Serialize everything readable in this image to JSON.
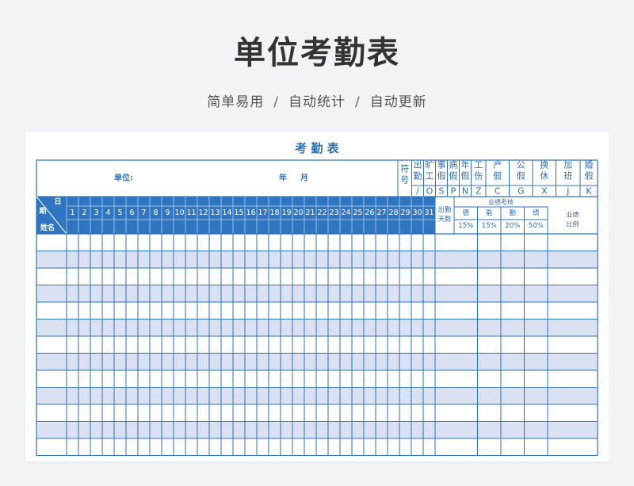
{
  "header": {
    "title": "单位考勤表",
    "subtitle_parts": [
      "简单易用",
      "自动统计",
      "自动更新"
    ],
    "subtitle_sep": "/"
  },
  "sheet": {
    "title": "考 勤 表",
    "unit_label": "单位:",
    "year_label": "年",
    "month_label": "月",
    "symbol_label": "符号",
    "leave_types": [
      {
        "name": "出勤",
        "symbol": "/"
      },
      {
        "name": "旷工",
        "symbol": "O"
      },
      {
        "name": "事假",
        "symbol": "S"
      },
      {
        "name": "病假",
        "symbol": "P"
      },
      {
        "name": "年假",
        "symbol": "N"
      },
      {
        "name": "工伤",
        "symbol": "Z"
      },
      {
        "name": "产假",
        "symbol": "C"
      },
      {
        "name": "公假",
        "symbol": "G"
      },
      {
        "name": "换休",
        "symbol": "X"
      },
      {
        "name": "加班",
        "symbol": "J"
      },
      {
        "name": "婚假",
        "symbol": "K"
      }
    ],
    "corner": {
      "day": "日",
      "period": "期",
      "name": "姓名"
    },
    "days": [
      "1",
      "2",
      "3",
      "4",
      "5",
      "6",
      "7",
      "8",
      "9",
      "10",
      "11",
      "12",
      "13",
      "14",
      "15",
      "16",
      "17",
      "18",
      "19",
      "20",
      "21",
      "22",
      "23",
      "24",
      "25",
      "26",
      "27",
      "28",
      "29",
      "30",
      "31"
    ],
    "attendance_days_label": "出勤天数",
    "perf_label": "业绩考核",
    "perf_items": [
      {
        "name": "德",
        "pct": "15%"
      },
      {
        "name": "能",
        "pct": "15%"
      },
      {
        "name": "勤",
        "pct": "20%"
      },
      {
        "name": "绩",
        "pct": "50%"
      }
    ],
    "perf_ratio_label": "业绩比例",
    "body_row_count": 13
  },
  "colors": {
    "blue": "#2f75c0",
    "grid": "#2e73b8",
    "stripe": "#d9e1f2",
    "text_blue": "#2f6fb3"
  }
}
